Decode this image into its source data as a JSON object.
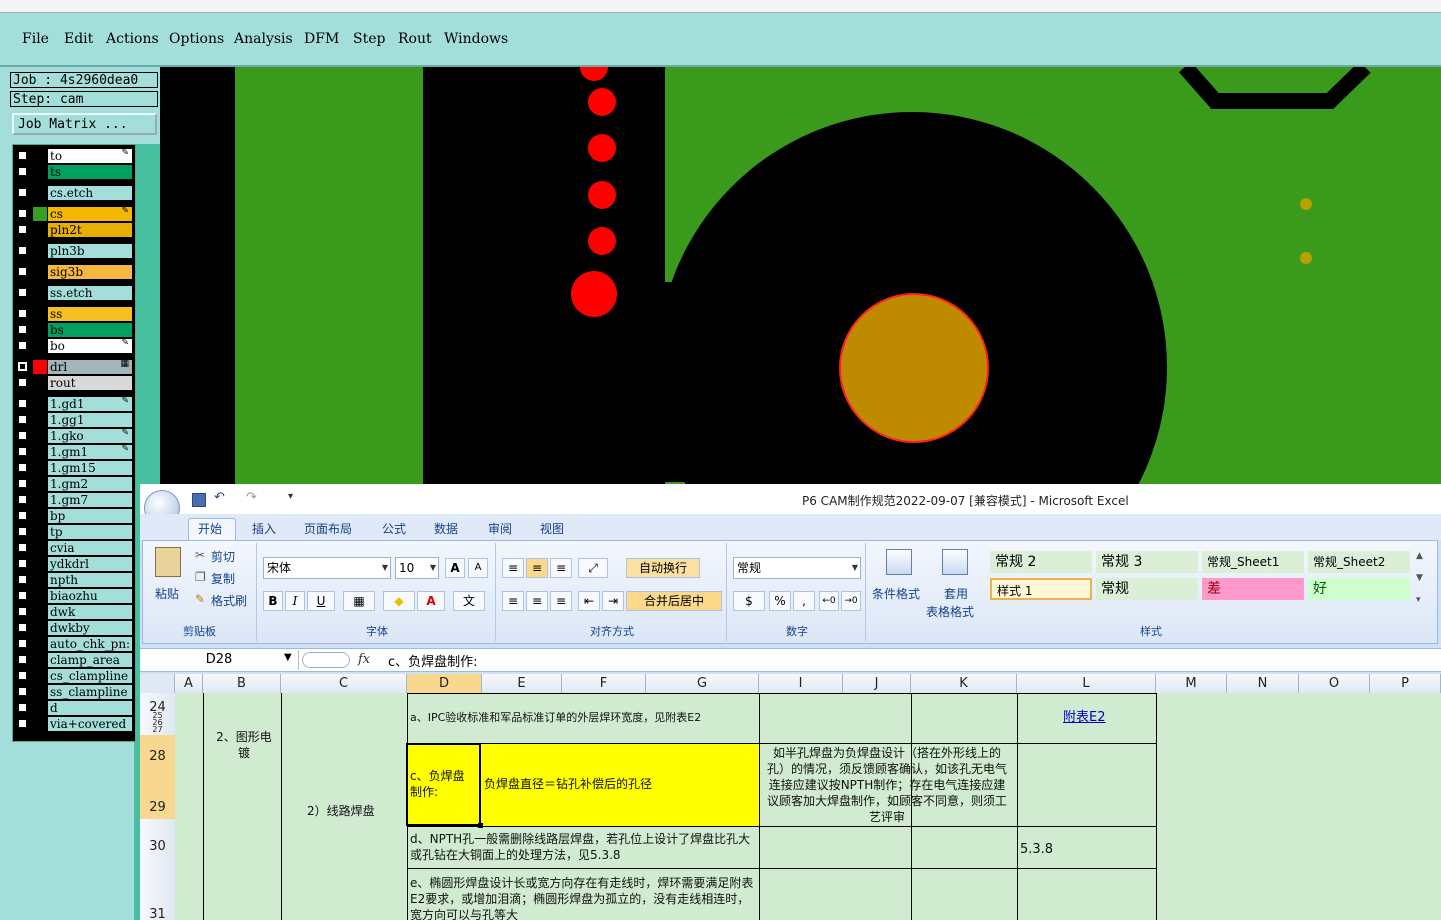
{
  "menubar": {
    "items": [
      "File",
      "Edit",
      "Actions",
      "Options",
      "Analysis",
      "DFM",
      "Step",
      "Rout",
      "Windows"
    ]
  },
  "job": {
    "job_label": "Job : 4s2960dea0",
    "step_label": "Step: cam",
    "matrix_button": "Job Matrix ..."
  },
  "layers": [
    {
      "name": "to",
      "color": "#ffffff",
      "swatch": "#000000",
      "tag": "✎",
      "checked": false
    },
    {
      "name": "ts",
      "color": "#00a060",
      "swatch": "#000000",
      "tag": "",
      "checked": false
    },
    {
      "name": "cs.etch",
      "color": "#a3dedb",
      "swatch": "#000000",
      "tag": "",
      "checked": false
    },
    {
      "name": "cs",
      "color": "#f5b800",
      "swatch": "#38a020",
      "tag": "✎",
      "checked": false
    },
    {
      "name": "pln2t",
      "color": "#e8b000",
      "swatch": "#000000",
      "tag": "",
      "checked": false
    },
    {
      "name": "pln3b",
      "color": "#a3dedb",
      "swatch": "#000000",
      "tag": "",
      "checked": false
    },
    {
      "name": "sig3b",
      "color": "#f5b840",
      "swatch": "#000000",
      "tag": "",
      "checked": false
    },
    {
      "name": "ss.etch",
      "color": "#a3dedb",
      "swatch": "#000000",
      "tag": "",
      "checked": false
    },
    {
      "name": "ss",
      "color": "#f5c020",
      "swatch": "#000000",
      "tag": "",
      "checked": false
    },
    {
      "name": "bs",
      "color": "#00a060",
      "swatch": "#000000",
      "tag": "",
      "checked": false
    },
    {
      "name": "bo",
      "color": "#ffffff",
      "swatch": "#000000",
      "tag": "✎",
      "checked": false
    },
    {
      "name": "drl",
      "color": "#a3b5b5",
      "swatch": "#ff0000",
      "tag": "▦",
      "checked": true
    },
    {
      "name": "rout",
      "color": "#d9d9d9",
      "swatch": "#000000",
      "tag": "",
      "checked": false
    },
    {
      "name": "1.gd1",
      "color": "#a3dedb",
      "swatch": "#000000",
      "tag": "✎",
      "checked": false
    },
    {
      "name": "1.gg1",
      "color": "#a3dedb",
      "swatch": "#000000",
      "tag": "",
      "checked": false
    },
    {
      "name": "1.gko",
      "color": "#a3dedb",
      "swatch": "#000000",
      "tag": "✎",
      "checked": false
    },
    {
      "name": "1.gm1",
      "color": "#a3dedb",
      "swatch": "#000000",
      "tag": "✎",
      "checked": false
    },
    {
      "name": "1.gm15",
      "color": "#a3dedb",
      "swatch": "#000000",
      "tag": "",
      "checked": false
    },
    {
      "name": "1.gm2",
      "color": "#a3dedb",
      "swatch": "#000000",
      "tag": "",
      "checked": false
    },
    {
      "name": "1.gm7",
      "color": "#a3dedb",
      "swatch": "#000000",
      "tag": "",
      "checked": false
    },
    {
      "name": "bp",
      "color": "#a3dedb",
      "swatch": "#000000",
      "tag": "",
      "checked": false
    },
    {
      "name": "tp",
      "color": "#a3dedb",
      "swatch": "#000000",
      "tag": "",
      "checked": false
    },
    {
      "name": "cvia",
      "color": "#a3dedb",
      "swatch": "#000000",
      "tag": "",
      "checked": false
    },
    {
      "name": "ydkdrl",
      "color": "#a3dedb",
      "swatch": "#000000",
      "tag": "",
      "checked": false
    },
    {
      "name": "npth",
      "color": "#a3dedb",
      "swatch": "#000000",
      "tag": "",
      "checked": false
    },
    {
      "name": "biaozhu",
      "color": "#a3dedb",
      "swatch": "#000000",
      "tag": "",
      "checked": false
    },
    {
      "name": "dwk",
      "color": "#a3dedb",
      "swatch": "#000000",
      "tag": "",
      "checked": false
    },
    {
      "name": "dwkby",
      "color": "#a3dedb",
      "swatch": "#000000",
      "tag": "",
      "checked": false
    },
    {
      "name": "auto_chk_pn:",
      "color": "#a3dedb",
      "swatch": "#000000",
      "tag": "",
      "checked": false
    },
    {
      "name": "clamp_area",
      "color": "#a3dedb",
      "swatch": "#000000",
      "tag": "",
      "checked": false
    },
    {
      "name": "cs_clampline",
      "color": "#a3dedb",
      "swatch": "#000000",
      "tag": "",
      "checked": false
    },
    {
      "name": "ss_clampline",
      "color": "#a3dedb",
      "swatch": "#000000",
      "tag": "",
      "checked": false
    },
    {
      "name": "d",
      "color": "#a3dedb",
      "swatch": "#000000",
      "tag": "",
      "checked": false
    },
    {
      "name": "via+covered",
      "color": "#a3dedb",
      "swatch": "#000000",
      "tag": "",
      "checked": false
    }
  ],
  "board": {
    "copper_color": "#3a9a1c",
    "pad_color": "#c08a00",
    "drill_color": "#ff0000"
  },
  "excel": {
    "title": "P6 CAM制作规范2022-09-07  [兼容模式] - Microsoft Excel",
    "tabs": [
      "开始",
      "插入",
      "页面布局",
      "公式",
      "数据",
      "审阅",
      "视图"
    ],
    "clipboard": {
      "paste": "粘贴",
      "cut": "剪切",
      "copy": "复制",
      "painter": "格式刷",
      "label": "剪贴板"
    },
    "font": {
      "name": "宋体",
      "size": "10",
      "label": "字体",
      "bold": "B",
      "italic": "I",
      "underline": "U",
      "grow": "A",
      "shrink": "A",
      "color_a": "A",
      "wen": "文"
    },
    "align": {
      "wrap": "自动换行",
      "merge": "合并后居中",
      "label": "对齐方式"
    },
    "number": {
      "format": "常规",
      "pct": "%",
      "comma": ",",
      "label": "数字"
    },
    "styles": {
      "cond": "条件格式",
      "table1": "套用",
      "table2": "表格格式",
      "label": "样式",
      "cells": [
        "常规 2",
        "常规 3",
        "常规_Sheet1",
        "常规_Sheet2",
        "样式 1",
        "常规",
        "差",
        "好"
      ]
    },
    "formula": {
      "cell": "D28",
      "fx": "fx",
      "content": "c、负焊盘制作:"
    },
    "columns": [
      "A",
      "B",
      "C",
      "D",
      "E",
      "F",
      "G",
      "I",
      "J",
      "K",
      "L",
      "M",
      "N",
      "O",
      "P"
    ],
    "rows": [
      "24",
      "25",
      "26",
      "27",
      "28",
      "29",
      "30",
      "31"
    ],
    "cells": {
      "b_group": "2、图形电镀",
      "c_group": "2）线路焊盘",
      "r24_d": "a、IPC验收标准和军品标准订单的外层焊环宽度，见附表E2",
      "r24_l": "附表E2",
      "r28_d": "c、负焊盘制作:",
      "r28_e": "负焊盘直径＝钻孔补偿后的孔径",
      "r28_i": "如半孔焊盘为负焊盘设计（搭在外形线上的孔）的情况，须反馈顾客确认，如该孔无电气连接应建议按NPTH制作；存在电气连接应建议顾客加大焊盘制作，如顾客不同意，则须工艺评审",
      "r30_d": "d、NPTH孔一般需删除线路层焊盘，若孔位上设计了焊盘比孔大或孔钻在大铜面上的处理方法，见5.3.8",
      "r30_l": "5.3.8",
      "r31_d": "e、椭圆形焊盘设计长或宽方向存在有走线时，焊环需要满足附表E2要求，或增加泪滴；椭圆形焊盘为孤立的，没有走线相连时，宽方向可以与孔等大"
    }
  }
}
